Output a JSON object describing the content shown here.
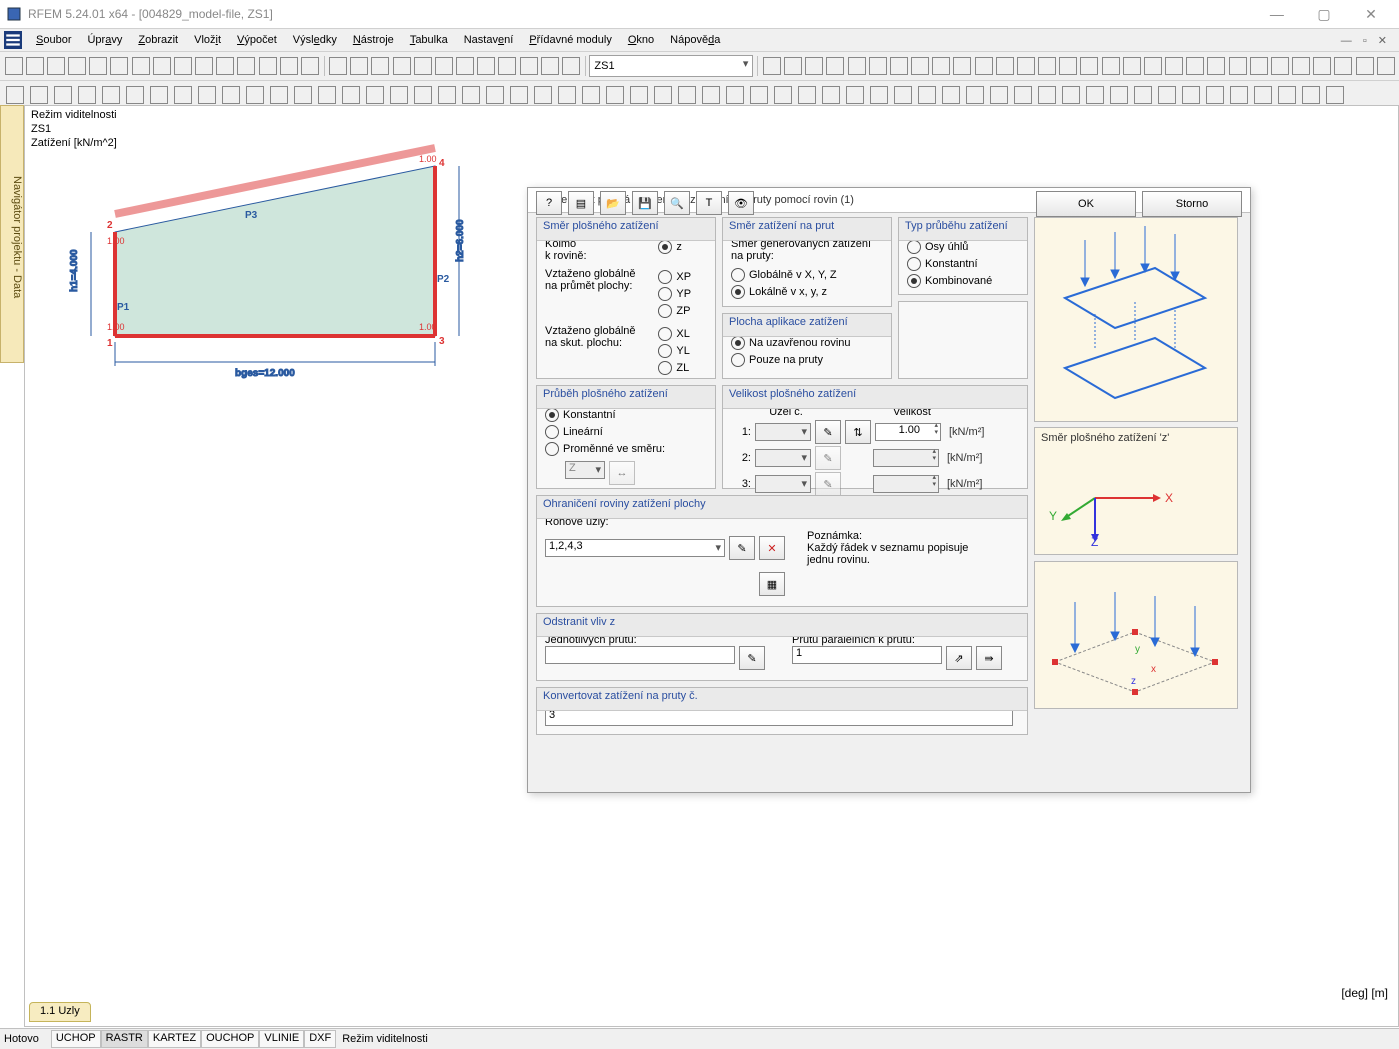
{
  "window": {
    "title": "RFEM 5.24.01 x64 - [004829_model-file, ZS1]",
    "win_min": "—",
    "win_max": "▢",
    "win_close": "✕"
  },
  "menu": {
    "soubor": "Soubor",
    "upravy": "Úpravy",
    "zobrazit": "Zobrazit",
    "vlozit": "Vložit",
    "vypocet": "Výpočet",
    "vysledky": "Výsledky",
    "nastroje": "Nástroje",
    "tabulka": "Tabulka",
    "nastaveni": "Nastavení",
    "pridavne": "Přídavné moduly",
    "okno": "Okno",
    "napoveda": "Nápověda"
  },
  "toolbar": {
    "combo_lc": "ZS1"
  },
  "navigator_tab": "Navigátor projektu - Data",
  "canvas": {
    "mode": "Režim viditelnosti",
    "lc": "ZS1",
    "load": "Zatížení [kN/m^2]",
    "dims": {
      "bges": "bges=12.000",
      "h1": "h1=4.000",
      "h2": "h2=6.000"
    },
    "labels": {
      "p1": "P1",
      "p2": "P2",
      "p3": "P3"
    },
    "nodes": {
      "n1": "1",
      "n2": "2",
      "n3": "3",
      "n4": "4"
    },
    "loadvals": {
      "l1": "1.00",
      "l2": "1.00",
      "l3": "1.00",
      "l4": "1.00"
    },
    "units_hint": "[deg] [m]"
  },
  "bottom_tab": "1.1 Uzly",
  "status": {
    "left": "Hotovo",
    "uchop": "UCHOP",
    "rastr": "RASTR",
    "kartez": "KARTEZ",
    "ouchop": "OUCHOP",
    "vlinie": "VLINIE",
    "dxf": "DXF",
    "mode": "Režim viditelnosti"
  },
  "dialog": {
    "title": "Konvertovat plošná zatížení na zatížení na pruty pomocí rovin   (1)",
    "close": "✕",
    "grp_dir": {
      "title": "Směr plošného zatížení",
      "kolmo": "Kolmo k rovině:",
      "kolmo_line1": "Kolmo",
      "kolmo_line2": "k rovině:",
      "z": "z",
      "vzt_proj": "Vztaženo globálně na průmět plochy:",
      "vzt_proj_line1": "Vztaženo globálně",
      "vzt_proj_line2": "na průmět plochy:",
      "xp": "XP",
      "yp": "YP",
      "zp": "ZP",
      "vzt_skut": "Vztaženo globálně na skut. plochu:",
      "vzt_skut_line1": "Vztaženo globálně",
      "vzt_skut_line2": "na skut. plochu:",
      "xl": "XL",
      "yl": "YL",
      "zl": "ZL"
    },
    "grp_member_dir": {
      "title": "Směr zatížení na prut",
      "desc": "Směr generovaných zatížení na pruty:",
      "global": "Globálně v X, Y, Z",
      "local": "Lokálně v x, y, z"
    },
    "grp_type": {
      "title": "Typ průběhu zatížení",
      "osy": "Osy úhlů",
      "konst": "Konstantní",
      "komb": "Kombinované"
    },
    "grp_app": {
      "title": "Plocha aplikace zatížení",
      "closed": "Na uzavřenou rovinu",
      "only": "Pouze na pruty"
    },
    "grp_course": {
      "title": "Průběh plošného zatížení",
      "konst": "Konstantní",
      "lin": "Lineární",
      "var": "Proměnné ve směru:",
      "axis": "Z"
    },
    "grp_mag": {
      "title": "Velikost plošného zatížení",
      "col_node": "Uzel č.",
      "col_mag": "Velikost",
      "r1": "1:",
      "r2": "2:",
      "r3": "3:",
      "val1": "1.00",
      "val2": "",
      "val3": "",
      "unit": "[kN/m²]"
    },
    "grp_bound": {
      "title": "Ohraničení roviny zatížení plochy",
      "corner_label": "Rohové uzly:",
      "corner_value": "1,2,4,3",
      "note_label": "Poznámka:",
      "note_text": "Každý řádek v seznamu popisuje jednu rovinu."
    },
    "grp_remove": {
      "title": "Odstranit vliv z",
      "indiv": "Jednotlivých prutů:",
      "parallel": "Prutů paralelních k prutu:",
      "par_val": "1"
    },
    "grp_convert": {
      "title": "Konvertovat zatížení na pruty č.",
      "value": "3"
    },
    "preview_caption": "Směr plošného zatížení 'z'",
    "ok": "OK",
    "cancel": "Storno"
  }
}
